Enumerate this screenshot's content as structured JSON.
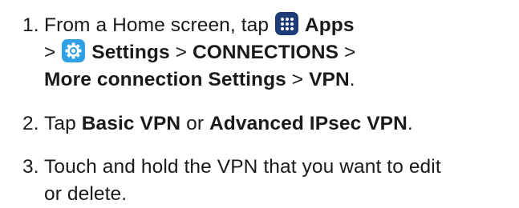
{
  "steps": [
    {
      "number": "1.",
      "line1": {
        "pre": "From a Home screen, tap ",
        "icon": "apps-grid-icon",
        "bold": "Apps"
      },
      "line2": {
        "pre": "> ",
        "icon": "settings-gear-icon",
        "bold1": "Settings",
        "sep1": " > ",
        "bold2": "CONNECTIONS",
        "post": " >"
      },
      "line3": {
        "bold1": "More connection Settings",
        "sep": " > ",
        "bold2": "VPN",
        "post": "."
      }
    },
    {
      "number": "2.",
      "pre": "Tap ",
      "bold1": "Basic VPN",
      "mid": " or ",
      "bold2": "Advanced IPsec VPN",
      "post": "."
    },
    {
      "number": "3.",
      "line1": "Touch and hold the VPN that you want to edit",
      "line2": "or delete."
    }
  ],
  "colors": {
    "apps_icon_bg": "#1d3c78",
    "settings_icon_bg": "#2fa0e4",
    "text": "#1a1a1a"
  }
}
